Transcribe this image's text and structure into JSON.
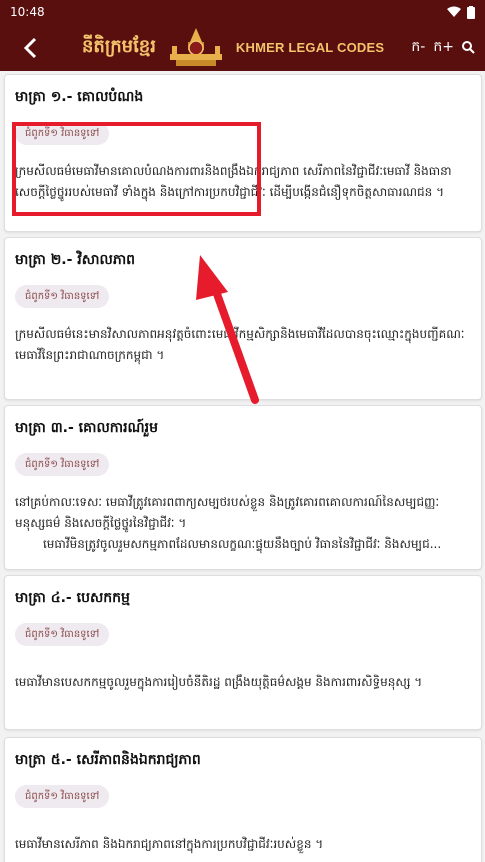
{
  "status": {
    "time": "10:48"
  },
  "appbar": {
    "logo_text": "នីតិក្រមខ្មែរ",
    "en_title": "KHMER LEGAL CODES",
    "font_dec_label": "ក-",
    "font_inc_label": "ក+"
  },
  "cards": [
    {
      "title": "មាត្រា ១.- គោលបំណង",
      "chip": "ជំពូកទី១ វិធានទូទៅ",
      "body": "ក្រមសីលធម៌មេធាវីមានគោលបំណងការពារនិងពង្រឹងឯករាជ្យភាព សេរីភាពនៃវិជ្ជាជីវៈមេធាវី និងធានាសេចក្ដីថ្លៃថ្នូររបស់មេធាវី ទាំងក្នុង និងក្រៅការប្រកបវិជ្ជាជីវៈ ដើម្បីបង្កើនជំនឿទុកចិត្តសាធារណជន ។"
    },
    {
      "title": "មាត្រា ២.- វិសាលភាព",
      "chip": "ជំពូកទី១ វិធានទូទៅ",
      "body": "ក្រមសីលធម៌នេះមានវិសាលភាពអនុវត្តចំពោះមេធាវីកម្មសិក្សានិងមេធាវីដែលបានចុះឈ្មោះក្នុងបញ្ជីគណៈមេធាវីនៃព្រះរាជាណាចក្រកម្ពុជា ។"
    },
    {
      "title": "មាត្រា ៣.- គោលការណ៍រួម",
      "chip": "ជំពូកទី១ វិធានទូទៅ",
      "body": "នៅគ្រប់កាលៈទេសៈ មេធាវីត្រូវគោរពពាក្យសម្បថរបស់ខ្លួន និងត្រូវគោរពគោលការណ៍នៃសម្បជញ្ញៈ មនុស្សធម៌ និងសេចក្ដីថ្លៃថ្នូរនៃវិជ្ជាជីវៈ ។",
      "body2": "មេធាវីមិនត្រូវចូលរួមសកម្មភាពដែលមានលក្ខណៈផ្ទុយនឹងច្បាប់ វិធាននៃវិជ្ជាជីវៈ និងសម្បជ..."
    },
    {
      "title": "មាត្រា ៤.- បេសកកម្ម",
      "chip": "ជំពូកទី១ វិធានទូទៅ",
      "body": "មេធាវីមានបេសកកម្មចូលរួមក្នុងការរៀបចំនីតិរដ្ឋ ពង្រឹងយុត្តិធម៌សង្គម និងការពារសិទ្ធិមនុស្ស ។"
    },
    {
      "title": "មាត្រា ៥.- សេរីភាពនិងឯករាជ្យភាព",
      "chip": "ជំពូកទី១ វិធានទូទៅ",
      "body": "មេធាវីមានសេរីភាព និងឯករាជ្យភាពនៅក្នុងការប្រកបវិជ្ជាជីវៈរបស់ខ្លួន ។"
    }
  ]
}
